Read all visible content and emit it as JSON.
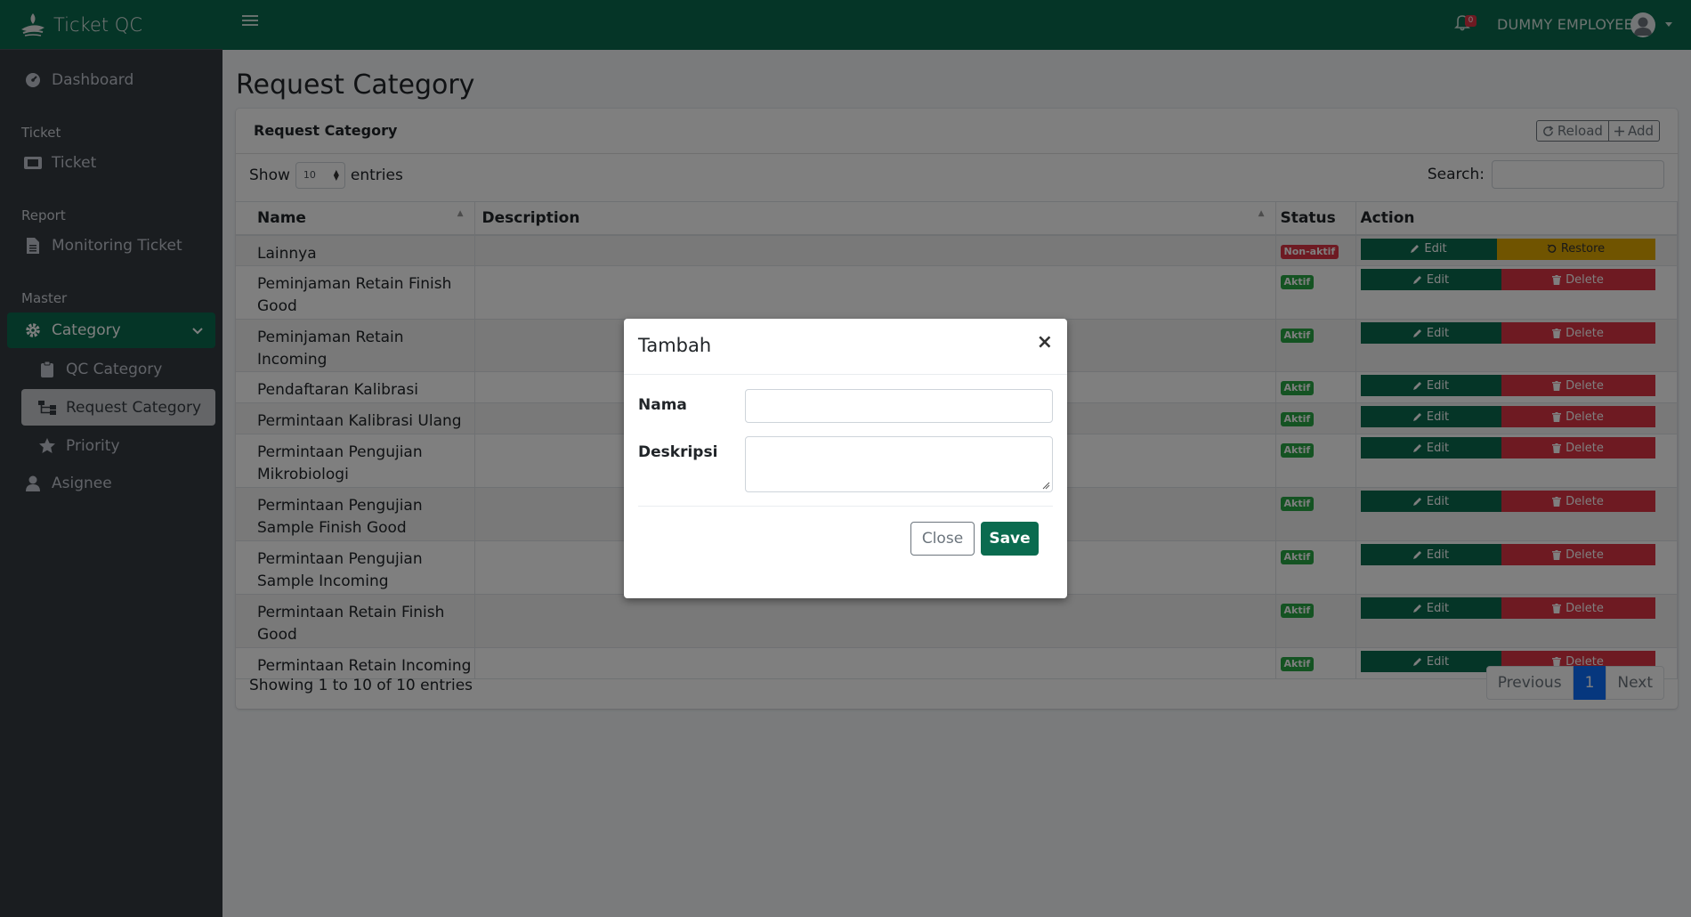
{
  "brand": {
    "name": "Ticket QC"
  },
  "topbar": {
    "notification_count": "0",
    "user_name": "DUMMY EMPLOYEE"
  },
  "sidebar": {
    "dashboard": "Dashboard",
    "section_ticket": "Ticket",
    "ticket": "Ticket",
    "section_report": "Report",
    "monitoring": "Monitoring Ticket",
    "section_master": "Master",
    "category": "Category",
    "qc_category": "QC Category",
    "request_category": "Request Category",
    "priority": "Priority",
    "asignee": "Asignee"
  },
  "page": {
    "title": "Request Category"
  },
  "card": {
    "title": "Request Category",
    "reload_label": "Reload",
    "add_label": "Add",
    "show_label": "Show",
    "length_value": "10",
    "entries_label": "entries",
    "search_label": "Search:",
    "search_value": ""
  },
  "table": {
    "columns": {
      "name": "Name",
      "description": "Description",
      "status": "Status",
      "action": "Action"
    },
    "edit_label": "Edit",
    "delete_label": "Delete",
    "restore_label": "Restore",
    "rows": [
      {
        "name_lines": [
          "Lainnya"
        ],
        "description": "",
        "status": "Non-aktif",
        "action": "Restore"
      },
      {
        "name_lines": [
          "Peminjaman Retain Finish",
          "Good"
        ],
        "description": "",
        "status": "Aktif",
        "action": "Delete"
      },
      {
        "name_lines": [
          "Peminjaman Retain Incoming"
        ],
        "description": "",
        "status": "Aktif",
        "action": "Delete"
      },
      {
        "name_lines": [
          "Pendaftaran Kalibrasi"
        ],
        "description": "",
        "status": "Aktif",
        "action": "Delete"
      },
      {
        "name_lines": [
          "Permintaan Kalibrasi Ulang"
        ],
        "description": "",
        "status": "Aktif",
        "action": "Delete"
      },
      {
        "name_lines": [
          "Permintaan Pengujian",
          "Mikrobiologi"
        ],
        "description": "",
        "status": "Aktif",
        "action": "Delete"
      },
      {
        "name_lines": [
          "Permintaan Pengujian",
          "Sample Finish Good"
        ],
        "description": "",
        "status": "Aktif",
        "action": "Delete"
      },
      {
        "name_lines": [
          "Permintaan Pengujian",
          "Sample Incoming"
        ],
        "description": "",
        "status": "Aktif",
        "action": "Delete"
      },
      {
        "name_lines": [
          "Permintaan Retain Finish",
          "Good"
        ],
        "description": "",
        "status": "Aktif",
        "action": "Delete"
      },
      {
        "name_lines": [
          "Permintaan Retain Incoming"
        ],
        "description": "",
        "status": "Aktif",
        "action": "Delete"
      }
    ],
    "info": "Showing 1 to 10 of 10 entries"
  },
  "pagination": {
    "previous": "Previous",
    "current": "1",
    "next": "Next"
  },
  "modal": {
    "title": "Tambah",
    "close_symbol": "×",
    "nama_label": "Nama",
    "nama_value": "",
    "deskripsi_label": "Deskripsi",
    "deskripsi_value": "",
    "close_label": "Close",
    "save_label": "Save"
  },
  "colors": {
    "primary": "#0a6b4f",
    "sidebar": "#343a40",
    "danger": "#dc3545",
    "success": "#28a745",
    "warning": "#e0a800",
    "page_active": "#0d6efd"
  }
}
